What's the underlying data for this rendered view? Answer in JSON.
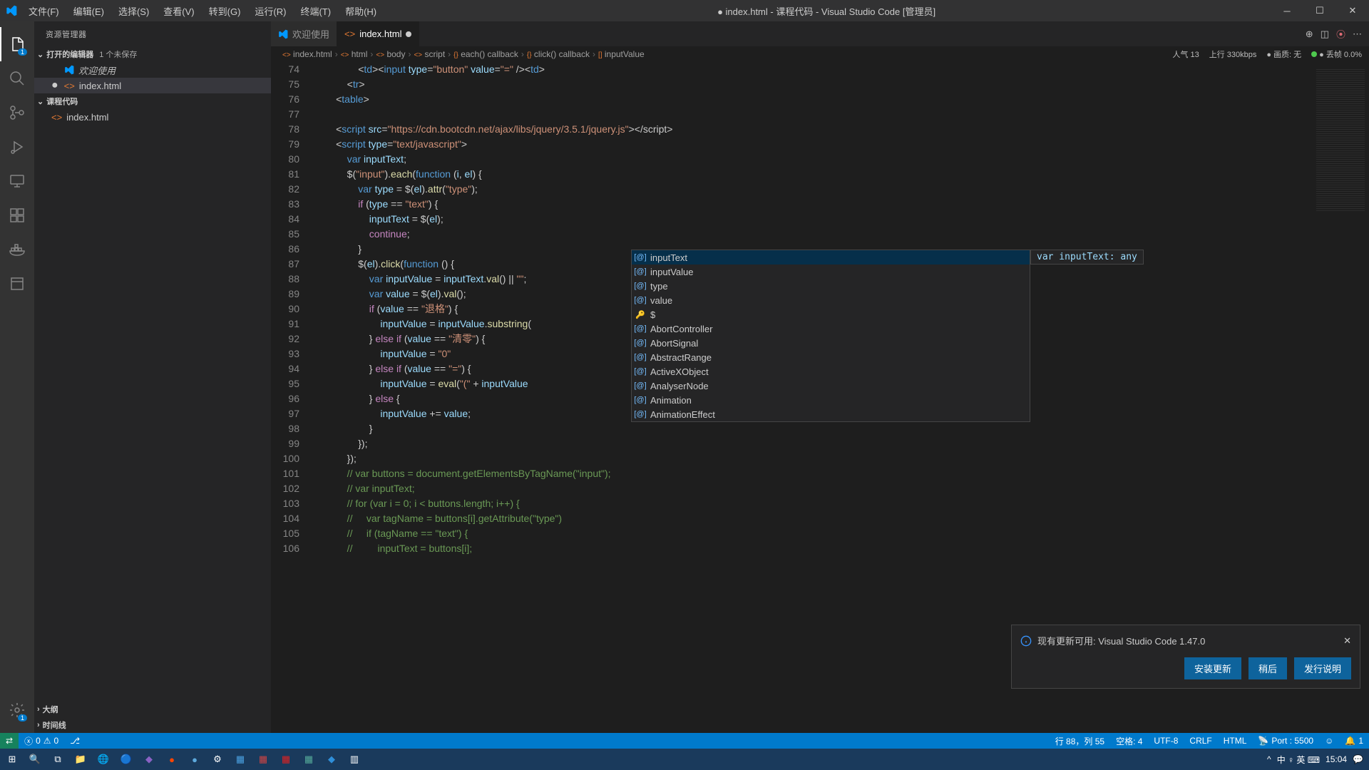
{
  "titlebar": {
    "menus": [
      "文件(F)",
      "编辑(E)",
      "选择(S)",
      "查看(V)",
      "转到(G)",
      "运行(R)",
      "终端(T)",
      "帮助(H)"
    ],
    "title": "● index.html - 课程代码 - Visual Studio Code [管理员]"
  },
  "sidebar": {
    "title": "资源管理器",
    "openEditors": {
      "label": "打开的编辑器",
      "badge": "1 个未保存"
    },
    "items": [
      {
        "name": "欢迎使用",
        "icon": "vscode",
        "italic": true
      },
      {
        "name": "index.html",
        "icon": "html",
        "modified": true
      }
    ],
    "workspace": {
      "label": "课程代码"
    },
    "wsItems": [
      {
        "name": "index.html",
        "icon": "html"
      }
    ],
    "outline": "大纲",
    "timeline": "时间线"
  },
  "tabs": [
    {
      "name": "欢迎使用",
      "icon": "vscode",
      "active": false
    },
    {
      "name": "index.html",
      "icon": "html",
      "active": true,
      "dirty": true
    }
  ],
  "tabStats": {
    "people": "人气  13",
    "uplink": "上行  330kbps",
    "quality": "● 画质: 无",
    "drop": "● 丢帧  0.0%"
  },
  "breadcrumbs": [
    "index.html",
    "html",
    "body",
    "script",
    "each() callback",
    "click() callback",
    "inputValue"
  ],
  "code": {
    "startLine": 74,
    "lines": [
      "                <td><input type=\"button\" value=\"=\" /></td>",
      "            </tr>",
      "        </table>",
      "",
      "        <script src=\"https://cdn.bootcdn.net/ajax/libs/jquery/3.5.1/jquery.js\"></​script>",
      "        <script type=\"text/javascript\">",
      "            var inputText;",
      "            $(\"input\").each(function (i, el) {",
      "                var type = $(el).attr(\"type\");",
      "                if (type == \"text\") {",
      "                    inputText = $(el);",
      "                    continue;",
      "                }",
      "                $(el).click(function () {",
      "                    var inputValue = inputText.val() || \"\";",
      "                    var value = $(el).val();",
      "                    if (value == \"退格\") {",
      "                        inputValue = inputValue.substring(",
      "                    } else if (value == \"清零\") {",
      "                        inputValue = \"0\"",
      "                    } else if (value == \"=\") {",
      "                        inputValue = eval(\"(\" + inputValue",
      "                    } else {",
      "                        inputValue += value;",
      "                    }",
      "                });",
      "            });",
      "            // var buttons = document.getElementsByTagName(\"input\");",
      "            // var inputText;",
      "            // for (var i = 0; i < buttons.length; i++) {",
      "            //     var tagName = buttons[i].getAttribute(\"type\")",
      "            //     if (tagName == \"text\") {",
      "            //         inputText = buttons[i];"
    ]
  },
  "suggest": {
    "docText": "var inputText: any",
    "items": [
      {
        "label": "inputText",
        "kind": "var",
        "selected": true
      },
      {
        "label": "inputValue",
        "kind": "var"
      },
      {
        "label": "type",
        "kind": "var"
      },
      {
        "label": "value",
        "kind": "var"
      },
      {
        "label": "$",
        "kind": "key"
      },
      {
        "label": "AbortController",
        "kind": "var"
      },
      {
        "label": "AbortSignal",
        "kind": "var"
      },
      {
        "label": "AbstractRange",
        "kind": "var"
      },
      {
        "label": "ActiveXObject",
        "kind": "var"
      },
      {
        "label": "AnalyserNode",
        "kind": "var"
      },
      {
        "label": "Animation",
        "kind": "var"
      },
      {
        "label": "AnimationEffect",
        "kind": "var"
      }
    ]
  },
  "notification": {
    "text": "现有更新可用: Visual Studio Code 1.47.0",
    "buttons": [
      "安装更新",
      "稍后",
      "发行说明"
    ]
  },
  "statusbar": {
    "errors": "0",
    "warnings": "0",
    "cursor": "行 88，列 55",
    "spaces": "空格: 4",
    "encoding": "UTF-8",
    "eol": "CRLF",
    "lang": "HTML",
    "port": "Port : 5500",
    "bell": "1"
  },
  "taskbar": {
    "time": "15:04",
    "ime": "中 ♀ 英 ⌨"
  }
}
